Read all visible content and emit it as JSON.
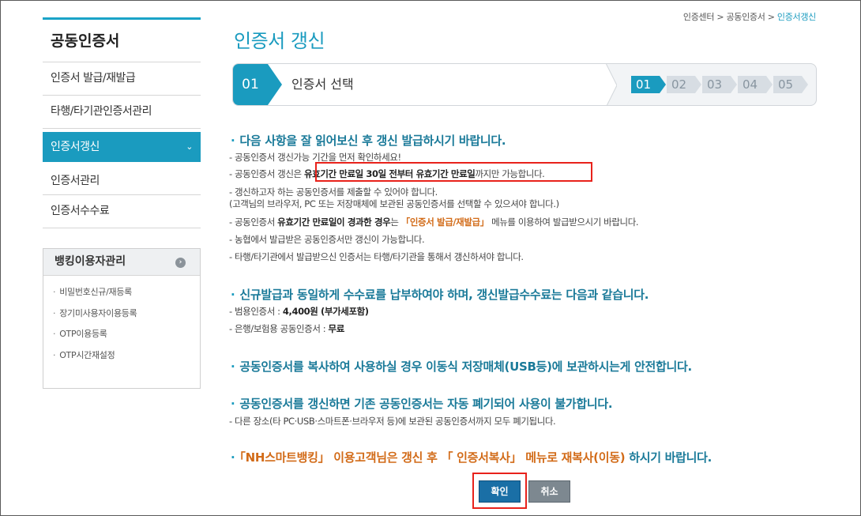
{
  "breadcrumb": {
    "items": [
      "인증센터",
      "공동인증서",
      "인증서갱신"
    ],
    "sep": " > "
  },
  "sidebar": {
    "title": "공동인증서",
    "items": [
      {
        "label": "인증서 발급/재발급"
      },
      {
        "label": "타행/타기관인증서관리"
      },
      {
        "label": "인증서갱신",
        "active": true
      },
      {
        "label": "인증서관리"
      },
      {
        "label": "인증서수수료"
      }
    ]
  },
  "banking": {
    "title": "뱅킹이용자관리",
    "items": [
      "비밀번호신규/재등록",
      "장기미사용자이용등록",
      "OTP이용등록",
      "OTP시간재설정"
    ]
  },
  "page": {
    "title": "인증서 갱신"
  },
  "step_bar": {
    "current_num": "01",
    "current_label": "인증서 선택",
    "steps": [
      "01",
      "02",
      "03",
      "04",
      "05"
    ]
  },
  "sections": [
    {
      "head": "다음 사항을 잘 읽어보신 후 갱신 발급하시기 바랍니다.",
      "lines": {
        "l1": "- 공동인증서 갱신가능 기간을 먼저 확인하세요!",
        "l2a": "- 공동인증서 갱신은 ",
        "l2b": "유효기간 만료일 30일 전부터 유효기간 만료일",
        "l2c": "까지만 가능합니다.",
        "l3": "- 갱신하고자 하는 공동인증서를 제출할 수 있어야 합니다.",
        "l4": "  (고객님의 브라우저, PC 또는 저장매체에 보관된 공동인증서를 선택할 수 있으셔야 합니다.)",
        "l5a": "- 공동인증서 ",
        "l5b": "유효기간 만료일이 경과한 경우",
        "l5c": "는 ",
        "l5d": "「인증서 발급/재발급」",
        "l5e": " 메뉴를 이용하여 발급받으시기 바랍니다.",
        "l6": "- 농협에서 발급받은 공동인증서만 갱신이 가능합니다.",
        "l7": "- 타행/타기관에서 발급받으신 인증서는 타행/타기관을 통해서 갱신하셔야 합니다."
      }
    },
    {
      "head": "신규발급과 동일하게 수수료를 납부하여야 하며, 갱신발급수수료는 다음과 같습니다.",
      "lines": {
        "l1a": "- 범용인증서 : ",
        "l1b": "4,400원 (부가세포함)",
        "l2a": "- 은행/보험용 공동인증서 : ",
        "l2b": "무료"
      }
    },
    {
      "head": "공동인증서를 복사하여 사용하실 경우 이동식 저장매체(USB등)에 보관하시는게 안전합니다."
    },
    {
      "head": "공동인증서를 갱신하면 기존 공동인증서는 자동 폐기되어 사용이 불가합니다.",
      "lines": {
        "l1": "- 다른 장소(타 PC·USB·스마트폰·브라우저 등)에 보관된 공동인증서까지 모두 폐기됩니다."
      }
    }
  ],
  "notice": {
    "a": "「NH스마트뱅킹」 이용고객님은 갱신 후 「 인증서복사」 메뉴로 재복사(이동) ",
    "b": "하시기 바랍니다."
  },
  "buttons": {
    "ok": "확인",
    "cancel": "취소"
  },
  "colors": {
    "accent": "#1a9bbf",
    "highlight_border": "#e8221b",
    "orange": "#d26b18"
  }
}
